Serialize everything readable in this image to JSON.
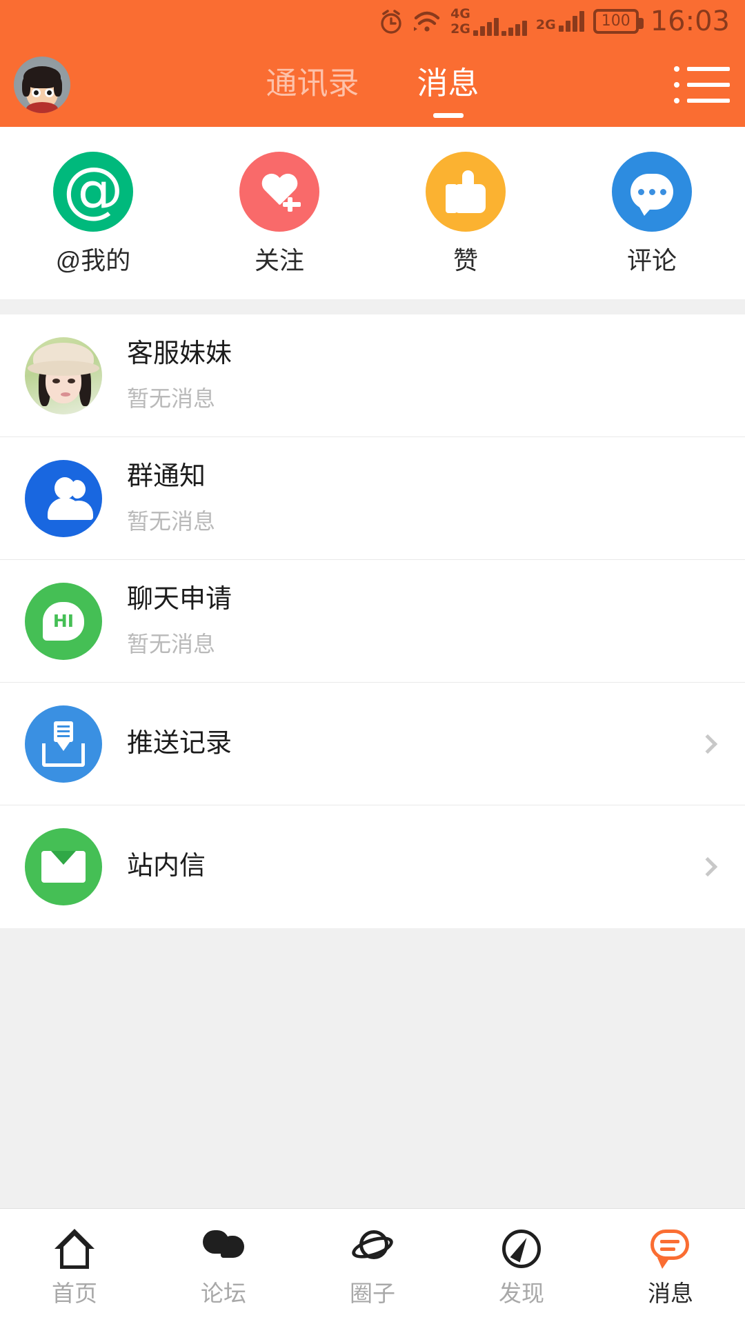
{
  "statusbar": {
    "alarm_icon": "alarm-clock-icon",
    "wifi_icon": "wifi-icon",
    "sim1_label_top": "4G",
    "sim1_label_bottom": "2G",
    "sim2_label": "2G",
    "battery_level": "100",
    "time": "16:03"
  },
  "header": {
    "avatar_icon": "user-avatar",
    "menu_icon": "list-menu-icon",
    "tabs": [
      {
        "label": "通讯录",
        "active": false
      },
      {
        "label": "消息",
        "active": true
      }
    ]
  },
  "quick_actions": [
    {
      "label": "@我的",
      "icon": "at-icon",
      "color": "#00b97c"
    },
    {
      "label": "关注",
      "icon": "heart-plus-icon",
      "color": "#f96a6a"
    },
    {
      "label": "赞",
      "icon": "thumbs-up-icon",
      "color": "#fbb231"
    },
    {
      "label": "评论",
      "icon": "comment-bubble-icon",
      "color": "#2d8ce0"
    }
  ],
  "messages": [
    {
      "title": "客服妹妹",
      "subtitle": "暂无消息",
      "icon": "photo-avatar",
      "has_chevron": false
    },
    {
      "title": "群通知",
      "subtitle": "暂无消息",
      "icon": "group-people-icon",
      "has_chevron": false
    },
    {
      "title": "聊天申请",
      "subtitle": "暂无消息",
      "icon": "hi-bubble-icon",
      "has_chevron": false
    },
    {
      "title": "推送记录",
      "subtitle": "",
      "icon": "inbox-download-icon",
      "has_chevron": true
    },
    {
      "title": "站内信",
      "subtitle": "",
      "icon": "envelope-icon",
      "has_chevron": true
    }
  ],
  "bottom_nav": [
    {
      "label": "首页",
      "icon": "home-icon",
      "active": false
    },
    {
      "label": "论坛",
      "icon": "forum-bubbles-icon",
      "active": false
    },
    {
      "label": "圈子",
      "icon": "planet-circle-icon",
      "active": false
    },
    {
      "label": "发现",
      "icon": "compass-icon",
      "active": false
    },
    {
      "label": "消息",
      "icon": "message-bubble-icon",
      "active": true
    }
  ],
  "colors": {
    "brand_orange": "#fa6d32",
    "page_background": "#f0f0f0",
    "card_background": "#ffffff"
  }
}
